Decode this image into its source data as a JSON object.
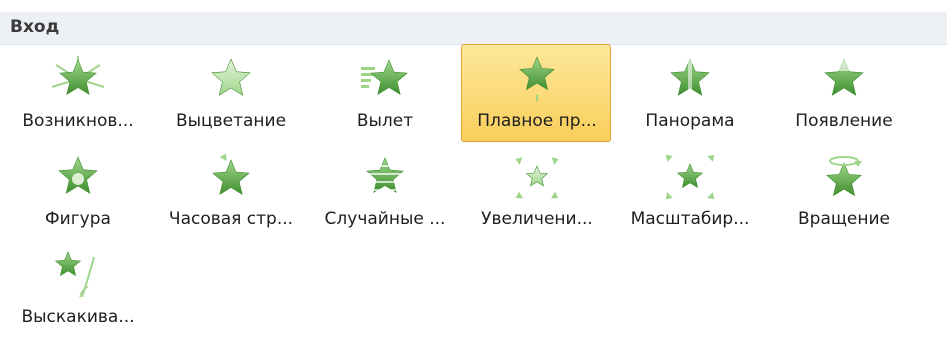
{
  "panel": {
    "title": "Вход",
    "effects": [
      {
        "label": "Возникнов...",
        "icon": "star-appear-icon",
        "selected": false
      },
      {
        "label": "Выцветание",
        "icon": "star-fade-icon",
        "selected": false
      },
      {
        "label": "Вылет",
        "icon": "star-fly-in-icon",
        "selected": false
      },
      {
        "label": "Плавное пр...",
        "icon": "star-float-in-icon",
        "selected": true
      },
      {
        "label": "Панорама",
        "icon": "star-split-icon",
        "selected": false
      },
      {
        "label": "Появление",
        "icon": "star-wipe-icon",
        "selected": false
      },
      {
        "label": "Фигура",
        "icon": "star-shape-icon",
        "selected": false
      },
      {
        "label": "Часовая стр...",
        "icon": "star-wheel-icon",
        "selected": false
      },
      {
        "label": "Случайные ...",
        "icon": "star-random-bars-icon",
        "selected": false
      },
      {
        "label": "Увеличени...",
        "icon": "star-grow-turn-icon",
        "selected": false
      },
      {
        "label": "Масштабир...",
        "icon": "star-zoom-icon",
        "selected": false
      },
      {
        "label": "Вращение",
        "icon": "star-swivel-icon",
        "selected": false
      },
      {
        "label": "Выскакива...",
        "icon": "star-bounce-icon",
        "selected": false
      }
    ]
  },
  "colors": {
    "star_dark": "#3f8f2f",
    "star_light": "#9fd58a",
    "selected_bg": "#fbd86a",
    "selected_border": "#dfa53a",
    "header_bg": "#edf0f5"
  }
}
